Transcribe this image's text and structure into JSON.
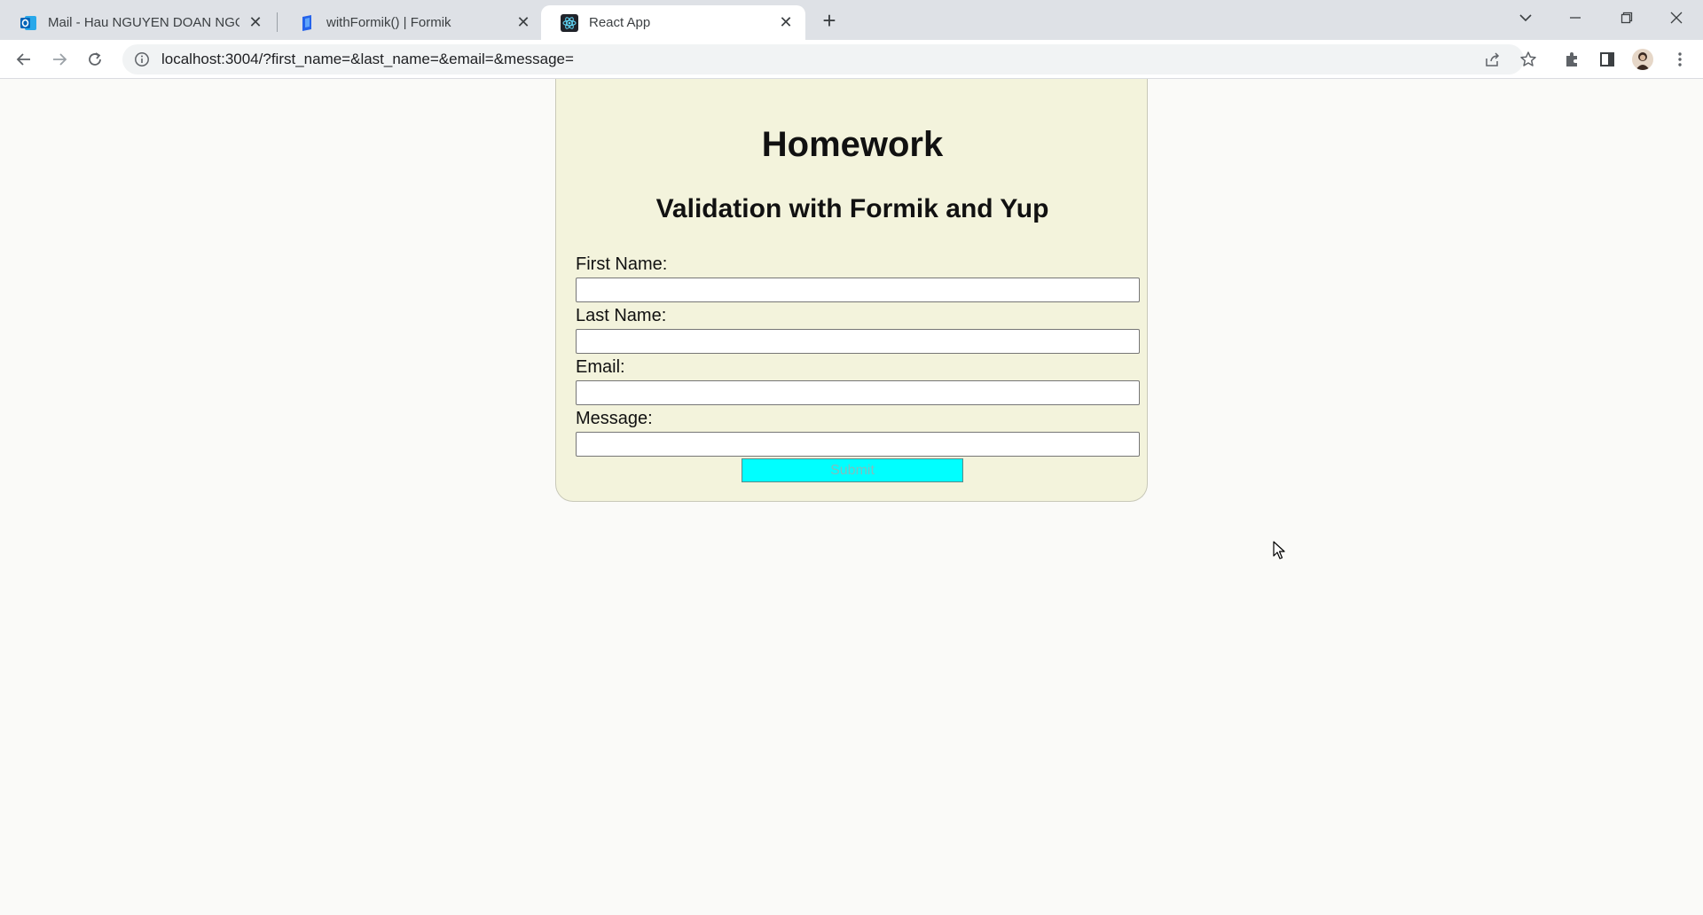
{
  "browser": {
    "tabs": [
      {
        "title": "Mail - Hau NGUYEN DOAN NGOC",
        "icon": "outlook-icon",
        "active": false
      },
      {
        "title": "withFormik() | Formik",
        "icon": "formik-icon",
        "active": false
      },
      {
        "title": "React App",
        "icon": "react-icon",
        "active": true
      }
    ],
    "url": "localhost:3004/?first_name=&last_name=&email=&message="
  },
  "page": {
    "heading": "Homework",
    "subheading": "Validation with Formik and Yup",
    "fields": [
      {
        "label": "First Name:",
        "value": ""
      },
      {
        "label": "Last Name:",
        "value": ""
      },
      {
        "label": "Email:",
        "value": ""
      },
      {
        "label": "Message:",
        "value": ""
      }
    ],
    "submit_label": "Submit"
  },
  "colors": {
    "card_bg": "#f3f3dc",
    "submit_bg": "#00ffff"
  }
}
